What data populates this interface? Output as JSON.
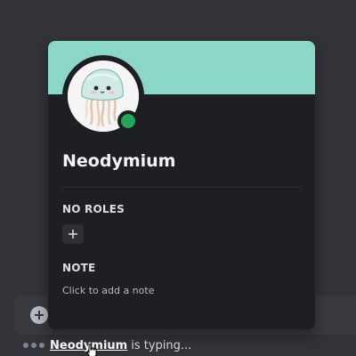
{
  "composer": {
    "add_icon": "plus-circle-icon"
  },
  "typing": {
    "user": "Neodymium",
    "suffix": "is typing..."
  },
  "profile": {
    "username": "Neodymium",
    "status": "online",
    "status_color": "#23a55a",
    "banner_color": "#8bd8c8",
    "avatar": "jellyfish-avatar",
    "roles_title": "NO ROLES",
    "add_role_icon": "plus-icon",
    "note_title": "NOTE",
    "note_placeholder": "Click to add a note"
  },
  "colors": {
    "background": "#313338",
    "popout": "#1e1f22",
    "composer": "#383a40"
  }
}
